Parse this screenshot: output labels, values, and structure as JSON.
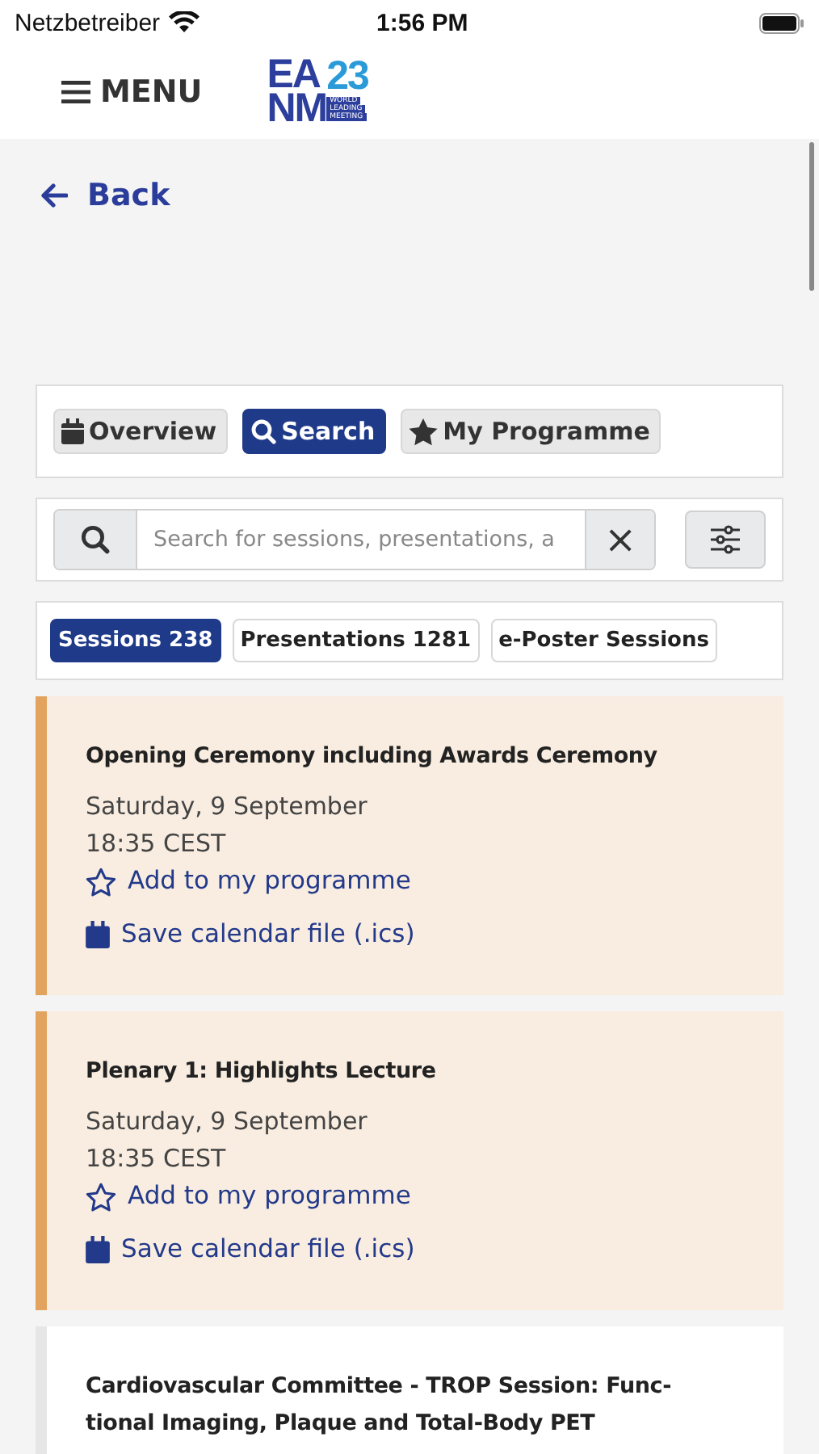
{
  "status_bar": {
    "carrier": "Netzbetreiber",
    "time": "1:56 PM"
  },
  "header": {
    "menu_label": "MENU",
    "logo": {
      "letters_top": "EA",
      "letters_bottom": "NM",
      "year": "23",
      "tagline": [
        "WORLD",
        "LEADING",
        "MEETING"
      ]
    }
  },
  "back_link": "Back",
  "view_tabs": [
    {
      "label": "Overview",
      "kind": "calendar",
      "selected": false
    },
    {
      "label": "Search",
      "kind": "search",
      "selected": true
    },
    {
      "label": "My Programme",
      "kind": "star",
      "selected": false
    }
  ],
  "search": {
    "placeholder": "Search for sessions, presentations, a",
    "clear_label": "×"
  },
  "result_tabs": [
    {
      "label": "Sessions 238",
      "selected": true
    },
    {
      "label": "Presentations 1281",
      "selected": false
    },
    {
      "label": "e-Poster Sessions",
      "selected": false
    }
  ],
  "sessions": [
    {
      "title": "Opening Ceremony including Awards Ceremony",
      "date": "Saturday, 9 September",
      "time": "18:35 CEST",
      "color": "#e2a35e",
      "add_label": "Add to my programme",
      "calendar_label": "Save calendar file (.ics)"
    },
    {
      "title": "Plenary 1: Highlights Lecture",
      "date": "Saturday, 9 September",
      "time": "18:35 CEST",
      "color": "#e2a35e",
      "add_label": "Add to my programme",
      "calendar_label": "Save calendar file (.ics)"
    },
    {
      "title": "Cardiovascular Committee - TROP Session: Func-\ntional Imaging, Plaque and Total-Body PET",
      "color": "#e6e6e6"
    }
  ]
}
